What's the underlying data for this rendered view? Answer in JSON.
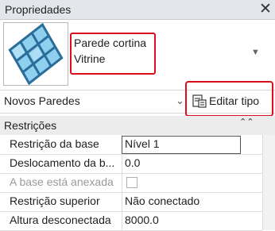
{
  "panel": {
    "title": "Propriedades",
    "close_glyph": "✕"
  },
  "type_selector": {
    "family": "Parede cortina",
    "type": "Vitrine",
    "dropdown_glyph": "▼",
    "thumbnail_icon": "curtain-wall-icon"
  },
  "instance_selector": {
    "label": "Novos Paredes",
    "dropdown_glyph": "⌄",
    "edit_type_label": "Editar tipo",
    "edit_type_icon": "edit-type-icon"
  },
  "section": {
    "title": "Restrições",
    "collapse_glyph": "⌃⌃"
  },
  "properties": [
    {
      "name": "Restrição da base",
      "value": "Nível 1",
      "editing": true
    },
    {
      "name": "Deslocamento da b...",
      "value": "0.0"
    },
    {
      "name": "A base está anexada",
      "value": "",
      "checkbox": true,
      "disabled": true
    },
    {
      "name": "Restrição superior",
      "value": "Não conectado"
    },
    {
      "name": "Altura desconectada",
      "value": "8000.0"
    }
  ],
  "colors": {
    "highlight": "#d8101d",
    "titlebar": "#e3e6ea",
    "thumb_glass": "#8fd0ef"
  }
}
